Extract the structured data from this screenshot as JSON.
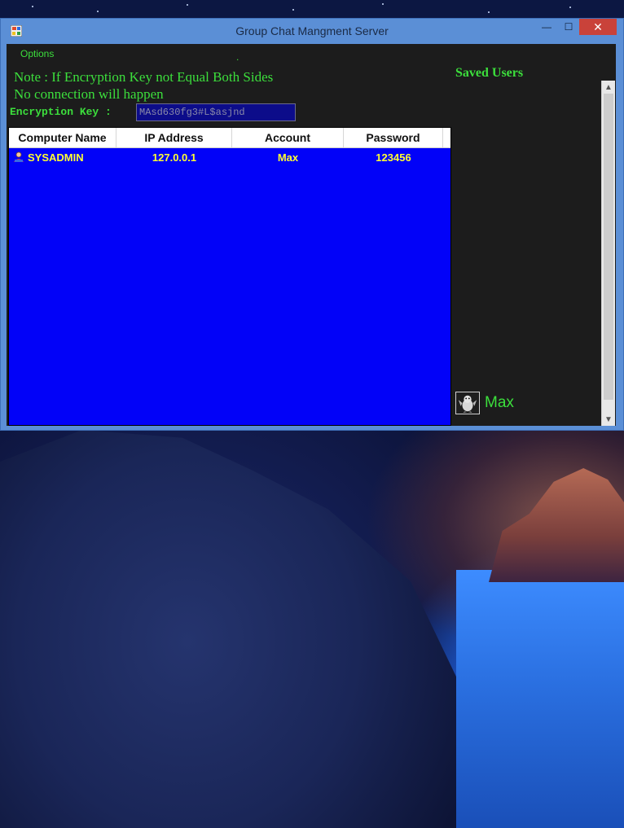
{
  "window": {
    "title": "Group Chat Mangment Server",
    "minimize": "—",
    "maximize": "☐",
    "close": "✕"
  },
  "menu": {
    "options": "Options",
    "dot": "."
  },
  "note": {
    "line1": "Note : If Encryption Key not Equal Both Sides",
    "line2": "No connection will happen"
  },
  "encryption": {
    "label": "Encryption Key  :",
    "value": "MAsd630fg3#L$asjnd"
  },
  "table": {
    "columns": [
      "Computer Name",
      "IP Address",
      "Account",
      "Password"
    ],
    "rows": [
      {
        "computer_name": "SYSADMIN",
        "ip_address": "127.0.0.1",
        "account": "Max",
        "password": "123456"
      }
    ]
  },
  "saved_users": {
    "title": "Saved Users",
    "users": [
      {
        "name": "Max",
        "icon": "penguin-avatar-icon"
      }
    ]
  },
  "colors": {
    "text_green": "#3cdf3c",
    "list_bg": "#0202f8",
    "row_text": "#ffff33",
    "panel_bg": "#1c1c1c",
    "titlebar": "#5b8fd6",
    "close_button": "#c9423a"
  }
}
